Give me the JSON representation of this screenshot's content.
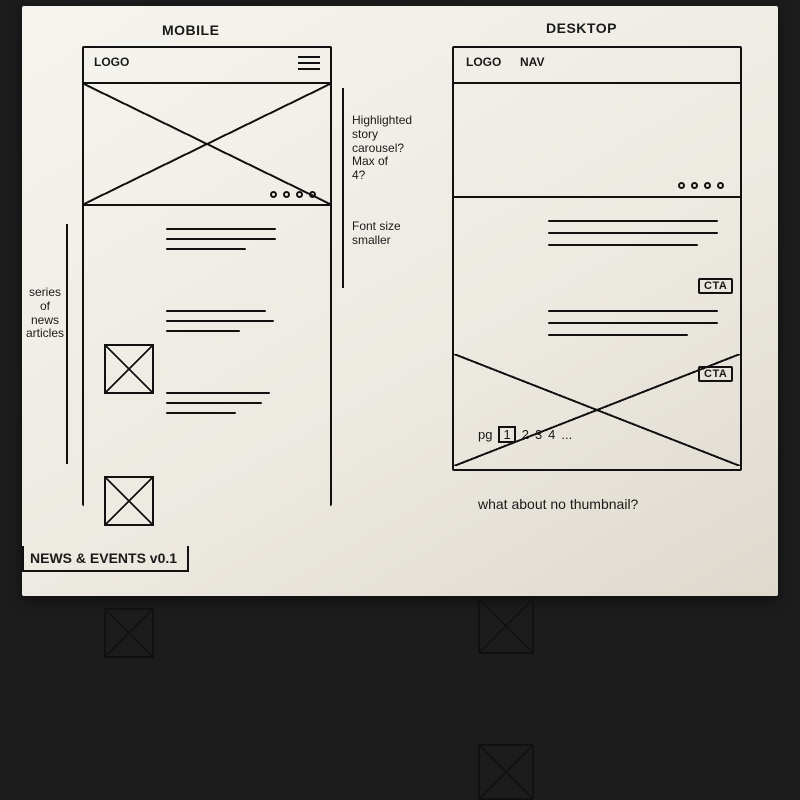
{
  "mobile": {
    "title": "MOBILE",
    "header": {
      "logo": "LOGO"
    },
    "articles": [
      {
        "lines": 3
      },
      {
        "lines": 3
      },
      {
        "lines": 3
      }
    ]
  },
  "desktop": {
    "title": "DESKTOP",
    "header": {
      "logo": "LOGO",
      "nav": "NAV"
    },
    "articles": [
      {
        "lines": 3,
        "cta": "CTA"
      },
      {
        "lines": 3,
        "cta": "CTA"
      }
    ],
    "pagination": {
      "label": "pg",
      "current": "1",
      "pages": [
        "2",
        "3",
        "4"
      ],
      "more": "..."
    }
  },
  "annotations": {
    "left": "series\nof\nnews\narticles",
    "right_top": "Highlighted\nstory\ncarousel?\nMax of\n4?",
    "right_bottom": "Font size\nsmaller",
    "bottom_right": "what about no thumbnail?"
  },
  "footer": {
    "title": "NEWS & EVENTS  v0.1"
  }
}
